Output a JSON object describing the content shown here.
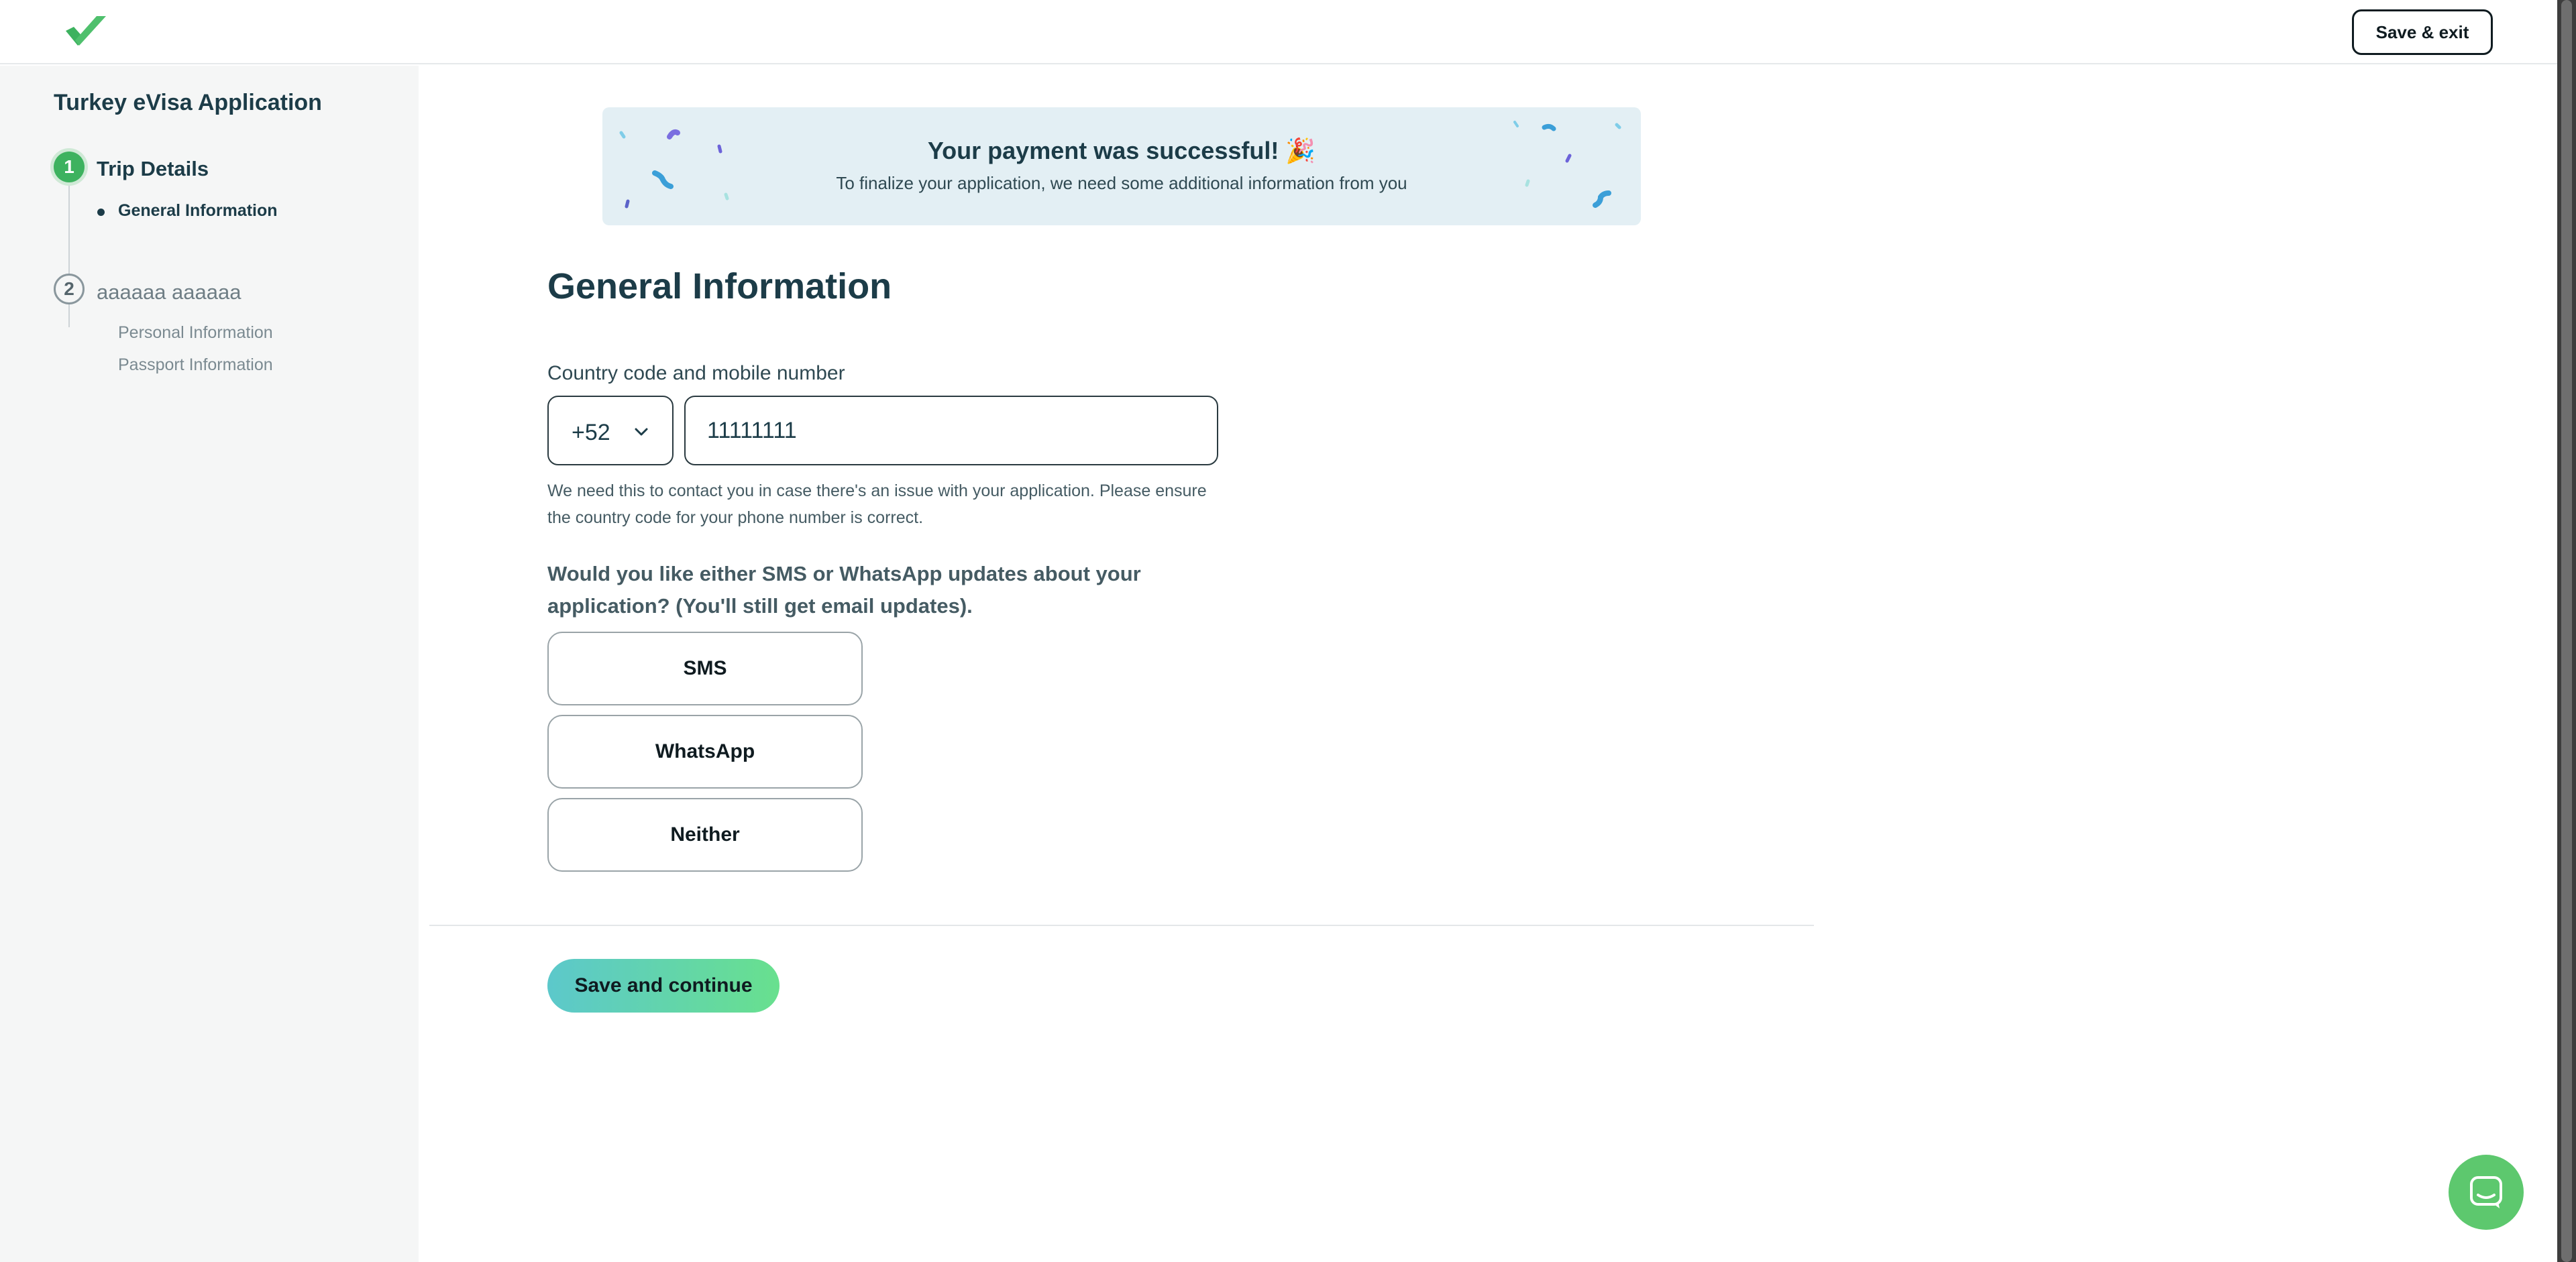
{
  "header": {
    "logo_icon": "checkmark-logo-icon",
    "save_exit_label": "Save & exit"
  },
  "sidebar": {
    "title": "Turkey eVisa Application",
    "steps": [
      {
        "number": "1",
        "label": "Trip Details",
        "state": "active",
        "items": [
          {
            "label": "General Information",
            "state": "active"
          }
        ]
      },
      {
        "number": "2",
        "label": "aaaaaa aaaaaa",
        "state": "upcoming",
        "items": [
          {
            "label": "Personal Information",
            "state": "upcoming"
          },
          {
            "label": "Passport Information",
            "state": "upcoming"
          }
        ]
      }
    ]
  },
  "banner": {
    "title": "Your payment was successful! 🎉",
    "subtitle": "To finalize your application, we need some additional information from you"
  },
  "main": {
    "page_title": "General Information",
    "phone": {
      "label": "Country code and mobile number",
      "country_code": "+52",
      "number_value": "11111111",
      "help_text": "We need this to contact you in case there's an issue with your application. Please ensure the country code for your phone number is correct."
    },
    "updates": {
      "question": "Would you like either SMS or WhatsApp updates about your application? (You'll still get email updates).",
      "options": [
        "SMS",
        "WhatsApp",
        "Neither"
      ]
    },
    "submit_label": "Save and continue"
  },
  "chat": {
    "icon": "chat-bubble-icon"
  },
  "colors": {
    "accent_green": "#3db25f",
    "banner_bg": "#e3eff4",
    "gradient_start": "#5cc8cb",
    "gradient_end": "#68e08e",
    "text_dark": "#1c3c48"
  }
}
